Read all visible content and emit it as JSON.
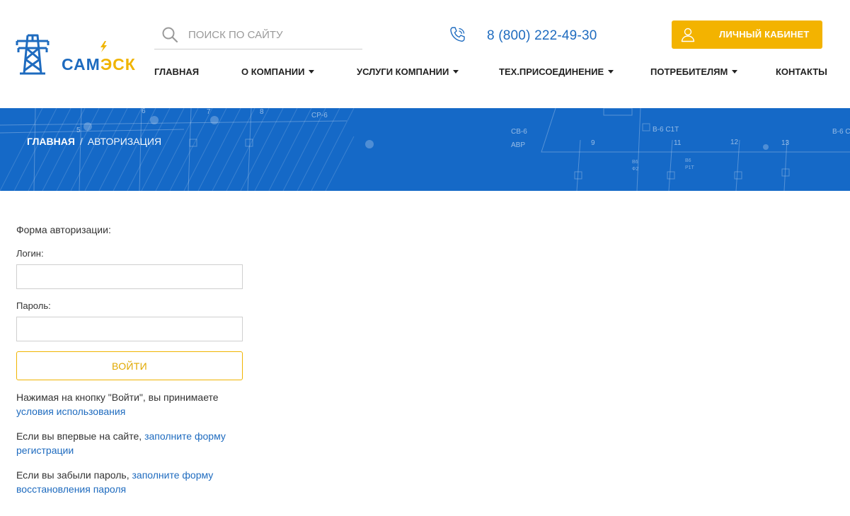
{
  "header": {
    "logo": {
      "text_part1": "САМ",
      "text_part2": "ЭСК"
    },
    "search": {
      "placeholder": "ПОИСК ПО САЙТУ",
      "value": ""
    },
    "phone": "8 (800) 222-49-30",
    "cabinet_label": "ЛИЧНЫЙ КАБИНЕТ"
  },
  "nav": {
    "items": [
      {
        "label": "ГЛАВНАЯ",
        "has_dropdown": false
      },
      {
        "label": "О КОМПАНИИ",
        "has_dropdown": true
      },
      {
        "label": "УСЛУГИ КОМПАНИИ",
        "has_dropdown": true
      },
      {
        "label": "ТЕХ.ПРИСОЕДИНЕНИЕ",
        "has_dropdown": true
      },
      {
        "label": "ПОТРЕБИТЕЛЯМ",
        "has_dropdown": true
      },
      {
        "label": "КОНТАКТЫ",
        "has_dropdown": false
      }
    ]
  },
  "banner": {
    "breadcrumb": {
      "home": "ГЛАВНАЯ",
      "separator": "/",
      "current": "АВТОРИЗАЦИЯ"
    },
    "diagram_labels": [
      "6",
      "7",
      "8",
      "5",
      "СР-6",
      "СВ-6",
      "АВР",
      "9",
      "В-6 С1Т",
      "11",
      "12",
      "13",
      "В-6 С",
      "В6",
      "Ф2",
      "В6",
      "Р1Т"
    ]
  },
  "form": {
    "title": "Форма авторизации:",
    "login_label": "Логин:",
    "login_value": "",
    "password_label": "Пароль:",
    "password_value": "",
    "submit_label": "ВОЙТИ",
    "terms_text": "Нажимая на кнопку \"Войти\", вы принимаете ",
    "terms_link": "условия использования",
    "register_text": "Если вы впервые на сайте, ",
    "register_link": "заполните форму регистрации",
    "recover_text": "Если вы забыли пароль, ",
    "recover_link": "заполните форму восстановления пароля"
  },
  "colors": {
    "brand_blue": "#1e6bbf",
    "brand_yellow": "#f3b300",
    "banner_blue": "#1569c7"
  }
}
